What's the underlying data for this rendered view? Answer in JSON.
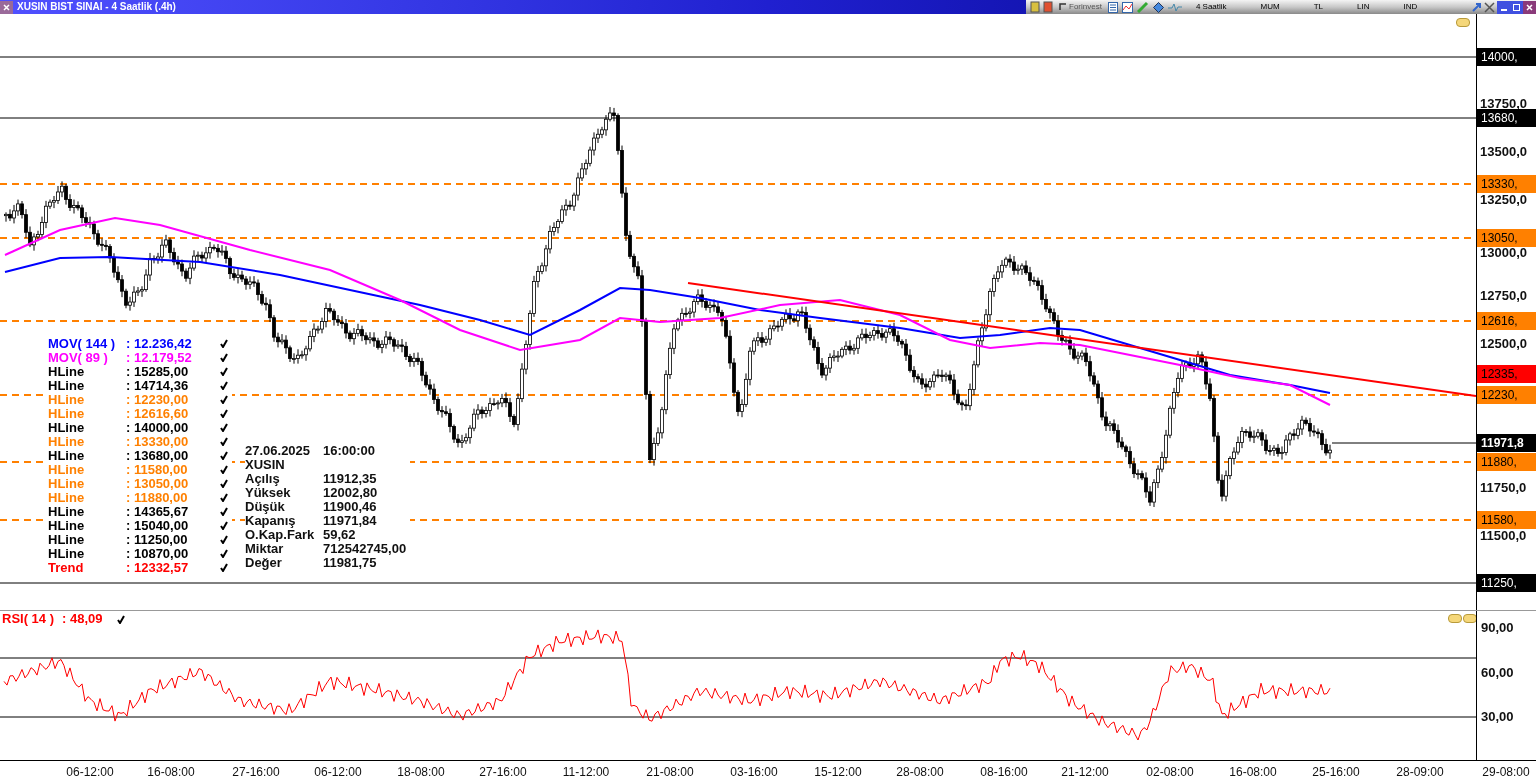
{
  "window": {
    "title": "XUSIN BIST SINAI - 4 Saatlik (.4h)"
  },
  "toolbar": {
    "brand": "Forinvest",
    "items": [
      "4 Saatlik",
      "MUM",
      "TL",
      "LIN",
      "IND"
    ]
  },
  "price_axis": {
    "ticks": [
      "13750,0",
      "13500,0",
      "13250,0",
      "13000,0",
      "12750,0",
      "12500,0",
      "11750,0",
      "11500,0"
    ]
  },
  "price_tags": [
    {
      "kind": "line",
      "text": "14000,"
    },
    {
      "kind": "line",
      "text": "13680,"
    },
    {
      "kind": "level",
      "text": "13330,"
    },
    {
      "kind": "level",
      "text": "13050,"
    },
    {
      "kind": "level",
      "text": "12616,"
    },
    {
      "kind": "trend",
      "text": "12335,"
    },
    {
      "kind": "level",
      "text": "12230,"
    },
    {
      "kind": "last",
      "text": "11971,8"
    },
    {
      "kind": "level",
      "text": "11880,"
    },
    {
      "kind": "level",
      "text": "11580,"
    },
    {
      "kind": "line",
      "text": "11250,"
    }
  ],
  "legend": [
    {
      "label": "MOV( 144 )",
      "value": ": 12.236,42",
      "color": "#0000ff"
    },
    {
      "label": "MOV( 89 )",
      "value": ": 12.179,52",
      "color": "#ff00ff"
    },
    {
      "label": "HLine",
      "value": ": 15285,00",
      "color": "#000000"
    },
    {
      "label": "HLine",
      "value": ": 14714,36",
      "color": "#000000"
    },
    {
      "label": "HLine",
      "value": ": 12230,00",
      "color": "#ff8000"
    },
    {
      "label": "HLine",
      "value": ": 12616,60",
      "color": "#ff8000"
    },
    {
      "label": "HLine",
      "value": ": 14000,00",
      "color": "#000000"
    },
    {
      "label": "HLine",
      "value": ": 13330,00",
      "color": "#ff8000"
    },
    {
      "label": "HLine",
      "value": ": 13680,00",
      "color": "#000000"
    },
    {
      "label": "HLine",
      "value": ": 11580,00",
      "color": "#ff8000"
    },
    {
      "label": "HLine",
      "value": ": 13050,00",
      "color": "#ff8000"
    },
    {
      "label": "HLine",
      "value": ": 11880,00",
      "color": "#ff8000"
    },
    {
      "label": "HLine",
      "value": ": 14365,67",
      "color": "#000000"
    },
    {
      "label": "HLine",
      "value": ": 15040,00",
      "color": "#000000"
    },
    {
      "label": "HLine",
      "value": ": 11250,00",
      "color": "#000000"
    },
    {
      "label": "HLine",
      "value": ": 10870,00",
      "color": "#000000"
    },
    {
      "label": "Trend",
      "value": ": 12332,57",
      "color": "#ff0000"
    }
  ],
  "info": {
    "date": "27.06.2025",
    "time": "16:00:00",
    "symbol": "XUSIN",
    "rows": [
      {
        "label": "Açılış",
        "value": "11912,35"
      },
      {
        "label": "Yüksek",
        "value": "12002,80"
      },
      {
        "label": "Düşük",
        "value": "11900,46"
      },
      {
        "label": "Kapanış",
        "value": "11971,84"
      },
      {
        "label": "O.Kap.Fark",
        "value": "59,62"
      },
      {
        "label": "Miktar",
        "value": "712542745,00"
      },
      {
        "label": "Değer",
        "value": "11981,75"
      }
    ]
  },
  "rsi": {
    "label": "RSI( 14 )",
    "value": ": 48,09",
    "ticks": [
      "90,00",
      "60,00",
      "30,00"
    ]
  },
  "x_axis": {
    "labels": [
      "06-12:00",
      "16-08:00",
      "27-16:00",
      "06-12:00",
      "18-08:00",
      "27-16:00",
      "11-12:00",
      "21-08:00",
      "03-16:00",
      "15-12:00",
      "28-08:00",
      "08-16:00",
      "21-12:00",
      "02-08:00",
      "16-08:00",
      "25-16:00",
      "28-09:00",
      "29-08:00"
    ]
  }
}
